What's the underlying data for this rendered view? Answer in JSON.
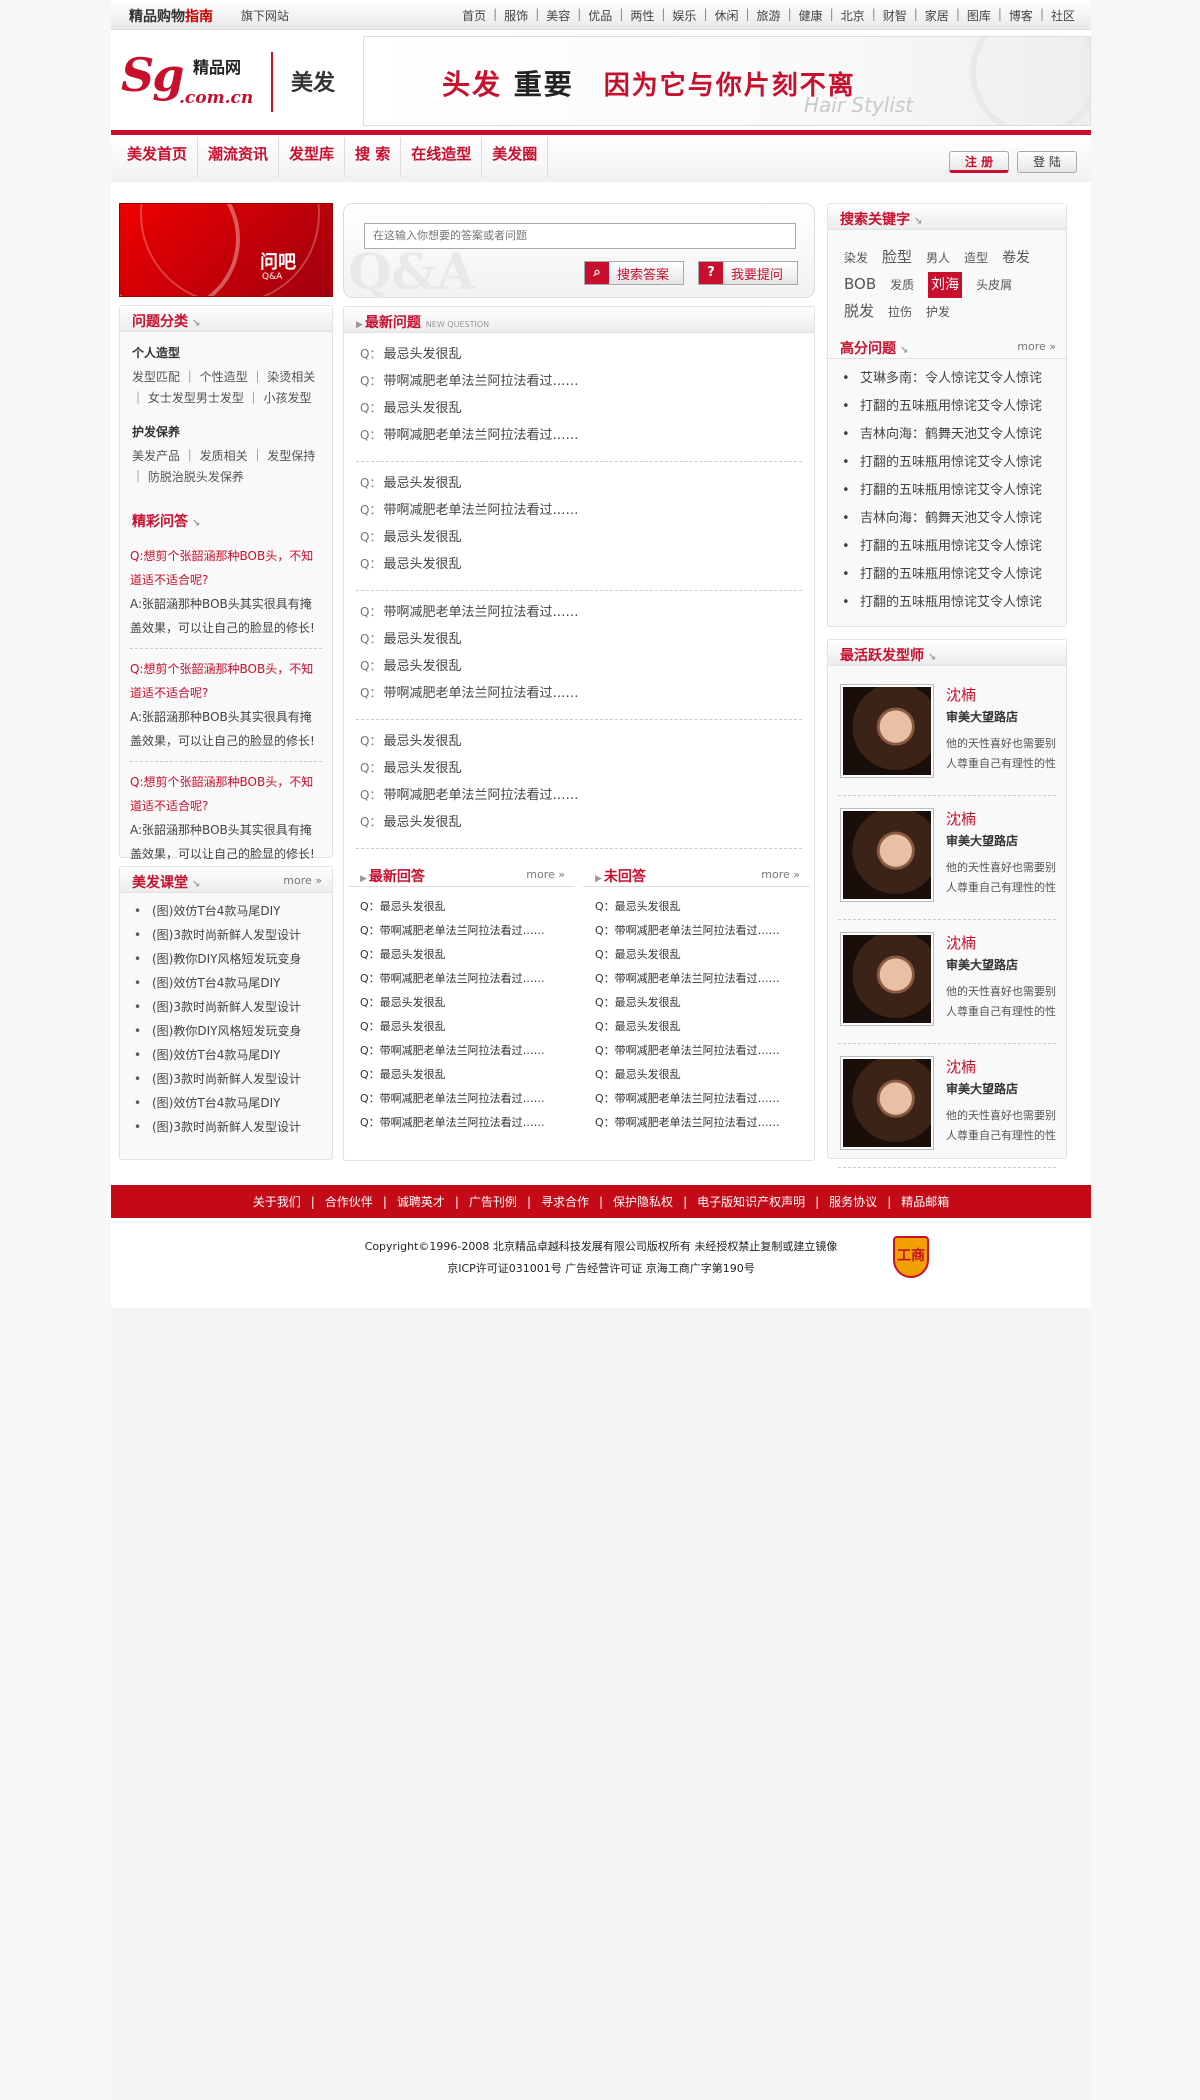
{
  "topbar": {
    "logo_main": "精品购物",
    "logo_accent": "指南",
    "sub_site": "旗下网站",
    "nav": [
      "首页",
      "服饰",
      "美容",
      "优品",
      "两性",
      "娱乐",
      "休闲",
      "旅游",
      "健康",
      "北京",
      "财智",
      "家居",
      "图库",
      "博客",
      "社区"
    ]
  },
  "header": {
    "logo_sg": "Sg",
    "logo_name": "精品网",
    "logo_domain": ".com.cn",
    "channel": "美发",
    "banner": {
      "part1": "头发",
      "part2": "重要",
      "part3": "因为它与你片刻不离",
      "tag": "Hair Stylist"
    }
  },
  "mainnav": {
    "items": [
      "美发首页",
      "潮流资讯",
      "发型库",
      "搜 索",
      "在线造型",
      "美发圈"
    ],
    "register": "注 册",
    "login": "登 陆"
  },
  "left": {
    "promo_title": "问吧",
    "promo_sub": "Q&A",
    "categories": {
      "title": "问题分类",
      "groups": [
        {
          "title": "个人造型",
          "links": "发型匹配 ｜ 个性造型 ｜ 染烫相关 ｜ 女士发型男士发型 ｜ 小孩发型"
        },
        {
          "title": "护发保养",
          "links": "美发产品 ｜ 发质相关 ｜ 发型保持 ｜ 防脱治脱头发保养"
        }
      ]
    },
    "featured": {
      "title": "精彩问答",
      "items": [
        {
          "q": "Q:想剪个张韶涵那种BOB头，不知道适不适合呢?",
          "a": "A:张韶涵那种BOB头其实很具有掩盖效果，可以让自己的脸显的修长!"
        },
        {
          "q": "Q:想剪个张韶涵那种BOB头，不知道适不适合呢?",
          "a": "A:张韶涵那种BOB头其实很具有掩盖效果，可以让自己的脸显的修长!"
        },
        {
          "q": "Q:想剪个张韶涵那种BOB头，不知道适不适合呢?",
          "a": "A:张韶涵那种BOB头其实很具有掩盖效果，可以让自己的脸显的修长!"
        }
      ]
    },
    "class": {
      "title": "美发课堂",
      "more": "more »",
      "items": [
        "(图)效仿T台4款马尾DIY",
        "(图)3款时尚新鲜人发型设计",
        "(图)教你DIY风格短发玩变身",
        "(图)效仿T台4款马尾DIY",
        "(图)3款时尚新鲜人发型设计",
        "(图)教你DIY风格短发玩变身",
        "(图)效仿T台4款马尾DIY",
        "(图)3款时尚新鲜人发型设计",
        "(图)效仿T台4款马尾DIY",
        "(图)3款时尚新鲜人发型设计"
      ]
    }
  },
  "center": {
    "search": {
      "placeholder": "在这输入你想要的答案或者问题",
      "btn_search": "搜索答案",
      "btn_ask": "我要提问",
      "bg_text": "Q&A"
    },
    "latest": {
      "title": "最新问题",
      "sub": "NEW QUESTION",
      "prefix": "Q：",
      "groups": [
        [
          "最忌头发很乱",
          "带啊减肥老单法兰阿拉法看过……",
          "最忌头发很乱",
          "带啊减肥老单法兰阿拉法看过……"
        ],
        [
          "最忌头发很乱",
          "带啊减肥老单法兰阿拉法看过……",
          "最忌头发很乱",
          "最忌头发很乱"
        ],
        [
          "带啊减肥老单法兰阿拉法看过……",
          "最忌头发很乱",
          "最忌头发很乱",
          "带啊减肥老单法兰阿拉法看过……"
        ],
        [
          "最忌头发很乱",
          "最忌头发很乱",
          "带啊减肥老单法兰阿拉法看过……",
          "最忌头发很乱"
        ]
      ]
    },
    "answered": {
      "title": "最新回答",
      "more": "more »",
      "items": [
        "Q：最忌头发很乱",
        "Q：带啊减肥老单法兰阿拉法看过……",
        "Q：最忌头发很乱",
        "Q：带啊减肥老单法兰阿拉法看过……",
        "Q：最忌头发很乱",
        "Q：最忌头发很乱",
        "Q：带啊减肥老单法兰阿拉法看过……",
        "Q：最忌头发很乱",
        "Q：带啊减肥老单法兰阿拉法看过……",
        "Q：带啊减肥老单法兰阿拉法看过……"
      ]
    },
    "unanswered": {
      "title": "未回答",
      "more": "more »",
      "items": [
        "Q：最忌头发很乱",
        "Q：带啊减肥老单法兰阿拉法看过……",
        "Q：最忌头发很乱",
        "Q：带啊减肥老单法兰阿拉法看过……",
        "Q：最忌头发很乱",
        "Q：最忌头发很乱",
        "Q：带啊减肥老单法兰阿拉法看过……",
        "Q：最忌头发很乱",
        "Q：带啊减肥老单法兰阿拉法看过……",
        "Q：带啊减肥老单法兰阿拉法看过……"
      ]
    }
  },
  "right": {
    "keywords": {
      "title": "搜索关键字",
      "words": [
        {
          "w": "染发",
          "s": "s"
        },
        {
          "w": "脸型",
          "s": "l"
        },
        {
          "w": "男人",
          "s": "s"
        },
        {
          "w": "造型",
          "s": "s"
        },
        {
          "w": "卷发",
          "s": "m"
        },
        {
          "w": "BOB",
          "s": "l"
        },
        {
          "w": "发质",
          "s": "s"
        },
        {
          "w": "刘海",
          "s": "hl"
        },
        {
          "w": "头皮屑",
          "s": "s"
        },
        {
          "w": "脱发",
          "s": "l"
        },
        {
          "w": "拉伤",
          "s": "s"
        },
        {
          "w": "护发",
          "s": "s"
        }
      ]
    },
    "top": {
      "title": "高分问题",
      "more": "more »",
      "items": [
        "艾琳多南：令人惊诧艾令人惊诧",
        "打翻的五味瓶用惊诧艾令人惊诧",
        "吉林向海：鹤舞天池艾令人惊诧",
        "打翻的五味瓶用惊诧艾令人惊诧",
        "打翻的五味瓶用惊诧艾令人惊诧",
        "吉林向海：鹤舞天池艾令人惊诧",
        "打翻的五味瓶用惊诧艾令人惊诧",
        "打翻的五味瓶用惊诧艾令人惊诧",
        "打翻的五味瓶用惊诧艾令人惊诧"
      ]
    },
    "stylists": {
      "title": "最活跃发型师",
      "items": [
        {
          "name": "沈楠",
          "shop": "审美大望路店",
          "desc": "他的天性喜好也需要别人尊重自己有理性的性"
        },
        {
          "name": "沈楠",
          "shop": "审美大望路店",
          "desc": "他的天性喜好也需要别人尊重自己有理性的性"
        },
        {
          "name": "沈楠",
          "shop": "审美大望路店",
          "desc": "他的天性喜好也需要别人尊重自己有理性的性"
        },
        {
          "name": "沈楠",
          "shop": "审美大望路店",
          "desc": "他的天性喜好也需要别人尊重自己有理性的性"
        }
      ]
    }
  },
  "footer": {
    "links": [
      "关于我们",
      "合作伙伴",
      "诚聘英才",
      "广告刊例",
      "寻求合作",
      "保护隐私权",
      "电子版知识产权声明",
      "服务协议",
      "精品邮箱"
    ],
    "copyright": "Copyright©1996-2008 北京精品卓越科技发展有限公司版权所有 未经授权禁止复制或建立镜像",
    "icp": "京ICP许可证031001号   广告经营许可证 京海工商广字第190号",
    "badge": "工商"
  }
}
